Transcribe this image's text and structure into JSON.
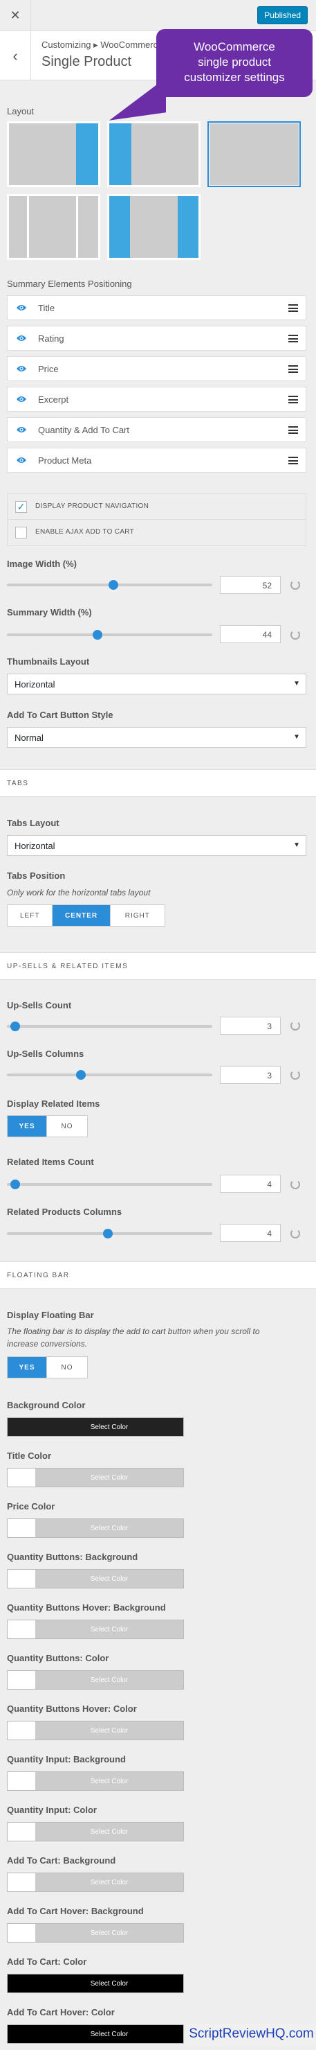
{
  "topbar": {
    "close_glyph": "✕",
    "publish_label": "Published"
  },
  "header": {
    "back_glyph": "‹",
    "breadcrumb": "Customizing ▸ WooCommerce",
    "title": "Single Product"
  },
  "callout": {
    "line1": "WooCommerce",
    "line2": "single product",
    "line3": "customizer settings"
  },
  "layout": {
    "label": "Layout",
    "selected_index": 2
  },
  "summary": {
    "label": "Summary Elements Positioning",
    "items": [
      "Title",
      "Rating",
      "Price",
      "Excerpt",
      "Quantity & Add To Cart",
      "Product Meta"
    ]
  },
  "checks": [
    {
      "label": "DISPLAY PRODUCT NAVIGATION",
      "checked": true
    },
    {
      "label": "ENABLE AJAX ADD TO CART",
      "checked": false
    }
  ],
  "image_width": {
    "label": "Image Width (%)",
    "value": "52",
    "fraction": 0.52
  },
  "summary_width": {
    "label": "Summary Width (%)",
    "value": "44",
    "fraction": 0.44
  },
  "thumbnails_layout": {
    "label": "Thumbnails Layout",
    "value": "Horizontal"
  },
  "add_to_cart_style": {
    "label": "Add To Cart Button Style",
    "value": "Normal"
  },
  "tabs_group": {
    "title": "TABS"
  },
  "tabs_layout": {
    "label": "Tabs Layout",
    "value": "Horizontal"
  },
  "tabs_position": {
    "label": "Tabs Position",
    "help": "Only work for the horizontal tabs layout",
    "options": [
      "LEFT",
      "CENTER",
      "RIGHT"
    ],
    "active": "CENTER"
  },
  "upsells_group": {
    "title": "UP-SELLS & RELATED ITEMS"
  },
  "upsells_count": {
    "label": "Up-Sells Count",
    "value": "3"
  },
  "upsells_columns": {
    "label": "Up-Sells Columns",
    "value": "3"
  },
  "display_related": {
    "label": "Display Related Items",
    "yes": "YES",
    "no": "NO",
    "active": "YES"
  },
  "related_count": {
    "label": "Related Items Count",
    "value": "4"
  },
  "related_columns": {
    "label": "Related Products Columns",
    "value": "4"
  },
  "floating_group": {
    "title": "FLOATING BAR"
  },
  "floating_bar": {
    "label": "Display Floating Bar",
    "help": "The floating bar is to display the add to cart button when you scroll to increase conversions.",
    "yes": "YES",
    "no": "NO",
    "active": "YES"
  },
  "select_color_text": "Select Color",
  "colors": [
    {
      "label": "Background Color",
      "swatch": "#222222",
      "bar": "#222222",
      "text_color": "#ffffff"
    },
    {
      "label": "Title Color",
      "swatch": "#ffffff",
      "bar": "#cccccc",
      "text_color": "#ffffff"
    },
    {
      "label": "Price Color",
      "swatch": "#ffffff",
      "bar": "#cccccc",
      "text_color": "#ffffff"
    },
    {
      "label": "Quantity Buttons: Background",
      "swatch": "#ffffff",
      "bar": "#cccccc",
      "text_color": "#ffffff"
    },
    {
      "label": "Quantity Buttons Hover: Background",
      "swatch": "#ffffff",
      "bar": "#cccccc",
      "text_color": "#ffffff"
    },
    {
      "label": "Quantity Buttons: Color",
      "swatch": "#ffffff",
      "bar": "#cccccc",
      "text_color": "#ffffff"
    },
    {
      "label": "Quantity Buttons Hover: Color",
      "swatch": "#ffffff",
      "bar": "#cccccc",
      "text_color": "#ffffff"
    },
    {
      "label": "Quantity Input: Background",
      "swatch": "#ffffff",
      "bar": "#cccccc",
      "text_color": "#ffffff"
    },
    {
      "label": "Quantity Input: Color",
      "swatch": "#ffffff",
      "bar": "#cccccc",
      "text_color": "#ffffff"
    },
    {
      "label": "Add To Cart: Background",
      "swatch": "#ffffff",
      "bar": "#cccccc",
      "text_color": "#ffffff"
    },
    {
      "label": "Add To Cart Hover: Background",
      "swatch": "#ffffff",
      "bar": "#cccccc",
      "text_color": "#ffffff"
    },
    {
      "label": "Add To Cart: Color",
      "swatch": "#000000",
      "bar": "#000000",
      "text_color": "#ffffff"
    },
    {
      "label": "Add To Cart Hover: Color",
      "swatch": "#000000",
      "bar": "#000000",
      "text_color": "#ffffff"
    }
  ],
  "watermark": "ScriptReviewHQ.com",
  "accent": "#2b8cd8"
}
